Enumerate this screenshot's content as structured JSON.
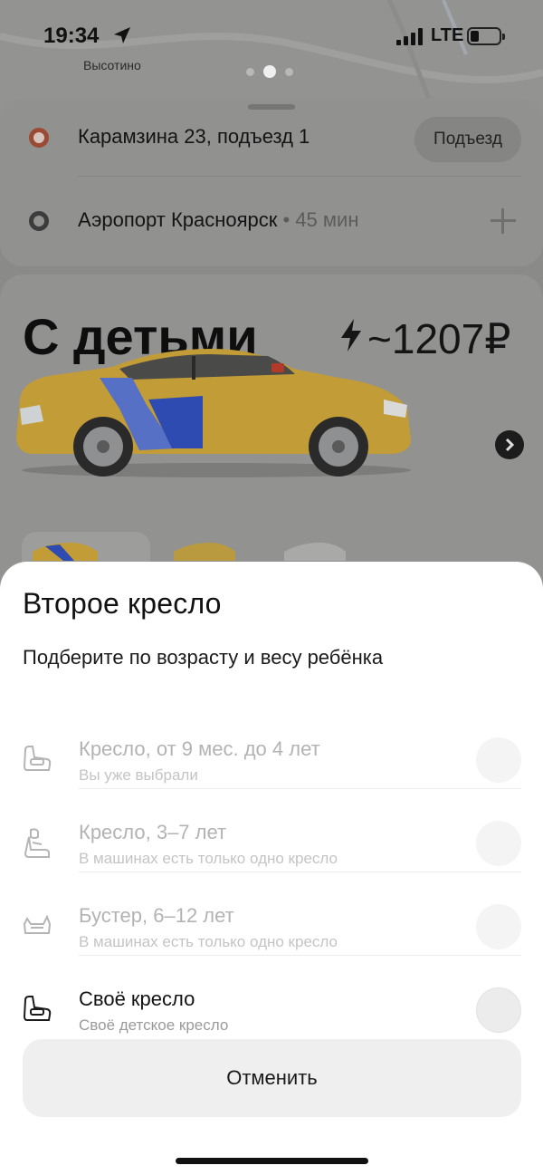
{
  "status_bar": {
    "time": "19:34",
    "network": "LTE",
    "map_label": "Высотино"
  },
  "route": {
    "from": "Карамзина 23, подъезд 1",
    "entrance_button": "Подъезд",
    "to": "Аэропорт Красноярск",
    "to_meta": " • 45 мин"
  },
  "tariff": {
    "name": "С детьми",
    "price": "~1207₽"
  },
  "sheet": {
    "title": "Второе кресло",
    "subtitle": "Подберите по возрасту и весу ребёнка",
    "options": [
      {
        "label": "Кресло, от 9 мес. до 4 лет",
        "desc": "Вы уже выбрали",
        "enabled": false
      },
      {
        "label": "Кресло, 3–7 лет",
        "desc": "В машинах есть только одно кресло",
        "enabled": false
      },
      {
        "label": "Бустер, 6–12 лет",
        "desc": "В машинах есть только одно кресло",
        "enabled": false
      },
      {
        "label": "Своё кресло",
        "desc": "Своё детское кресло",
        "enabled": true
      }
    ],
    "cancel_label": "Отменить"
  },
  "colors": {
    "overlay_bg": "#929291",
    "sheet_bg": "#ffffff",
    "car_yellow": "#c9a23a",
    "brand_blue": "#2f4fbd",
    "origin_dot": "#9b4a33"
  }
}
